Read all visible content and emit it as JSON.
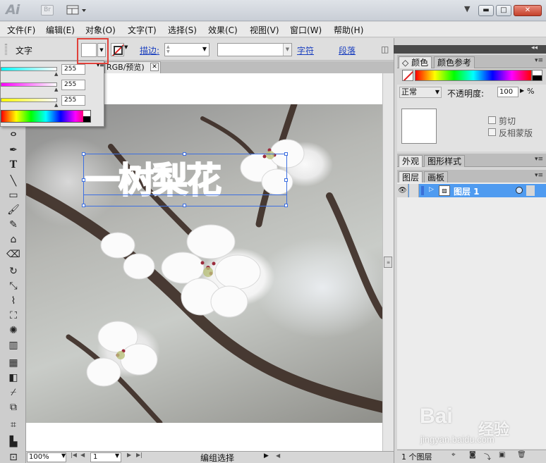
{
  "titlebar": {
    "app_logo": "Ai",
    "bridge": "Br",
    "minimize": "▬",
    "maximize": "□",
    "close": "✕"
  },
  "menu": [
    "文件(F)",
    "编辑(E)",
    "对象(O)",
    "文字(T)",
    "选择(S)",
    "效果(C)",
    "视图(V)",
    "窗口(W)",
    "帮助(H)"
  ],
  "control_bar": {
    "type_label": "文字",
    "stroke_label": "描边:",
    "character_link": "字符",
    "paragraph_link": "段落"
  },
  "color_popup": {
    "channels": [
      {
        "name": "R",
        "value": "255",
        "color": "#ff0000"
      },
      {
        "name": "G",
        "value": "255",
        "color": "#00ff00"
      },
      {
        "name": "B",
        "value": "255",
        "color": "#0000ff"
      }
    ]
  },
  "document": {
    "tab_title": "RGB/预览)",
    "tab_close": "✕",
    "text_content": "一树梨花"
  },
  "right_panels": {
    "color_tabs": [
      "颜色",
      "颜色参考"
    ],
    "transparency": {
      "blend_mode": "正常",
      "opacity_label": "不透明度:",
      "opacity_value": "100",
      "opacity_unit": "%",
      "clip_label": "剪切",
      "invert_mask_label": "反相蒙版"
    },
    "appearance_tabs": [
      "外观",
      "图形样式"
    ],
    "layers_tabs": [
      "图层",
      "画板"
    ],
    "layers": [
      {
        "name": "图层 1",
        "color": "#3a6fd8"
      }
    ],
    "layers_count": "1 个图层"
  },
  "status_bar": {
    "zoom": "100%",
    "page": "1",
    "status": "编组选择"
  },
  "watermark": {
    "logo": "Bai",
    "text": "经验",
    "url": "jingyan.baidu.com"
  },
  "colors": {
    "highlight": "#e0413a",
    "selection": "#3d6fe0",
    "layer_selected": "#4f9bf0",
    "link": "#1a3fbf"
  }
}
